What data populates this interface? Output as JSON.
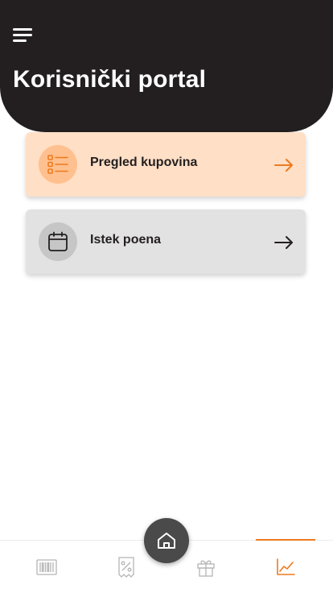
{
  "header": {
    "title": "Korisnički portal"
  },
  "cards": [
    {
      "label": "Pregled kupovina",
      "icon": "list-icon",
      "color": "#ffdfc6",
      "accent": "#ee7a1f"
    },
    {
      "label": "Istek poena",
      "icon": "calendar-icon",
      "color": "#e2e2e2",
      "accent": "#231f20"
    }
  ],
  "bottom_nav": {
    "items": [
      {
        "icon": "barcode-icon",
        "active": false
      },
      {
        "icon": "discount-icon",
        "active": false
      },
      {
        "icon": "gift-icon",
        "active": false
      },
      {
        "icon": "chart-icon",
        "active": true
      }
    ],
    "center_button_icon": "home-icon"
  },
  "colors": {
    "header_bg": "#231f20",
    "accent": "#ee7a1f",
    "inactive_icon": "#b5b5b5"
  }
}
